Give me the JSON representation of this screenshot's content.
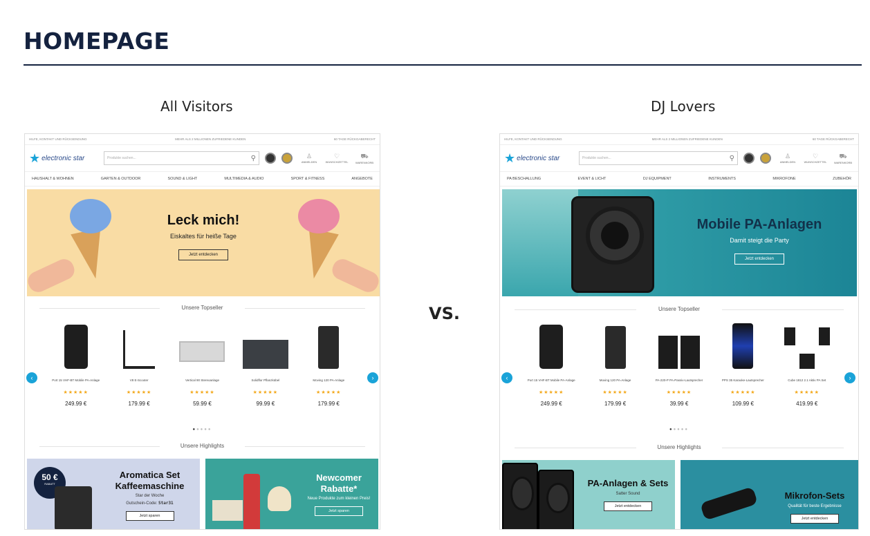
{
  "title": "HOMEPAGE",
  "vs": "VS.",
  "shared": {
    "topbar_left": "HILFE, KONTAKT UND RÜCKSENDUNG",
    "topbar_center": "MEHR ALS 2 MILLIONEN ZUFRIEDENE KUNDEN",
    "topbar_right": "60 TAGE RÜCKGABERECHT",
    "logo": "electronic star",
    "search_placeholder": "Produkte suchen...",
    "icon_login": "ANMELDEN",
    "icon_wishlist": "WUNSCHZETTEL",
    "icon_cart": "WARENKORB",
    "topseller": "Unsere Topseller",
    "highlights": "Unsere Highlights",
    "stars": "★★★★★"
  },
  "left": {
    "heading": "All Visitors",
    "nav": [
      "HAUSHALT & WOHNEN",
      "GARTEN & OUTDOOR",
      "SOUND & LIGHT",
      "MULTIMEDIA & AUDIO",
      "SPORT & FITNESS",
      "ANGEBOTE"
    ],
    "hero": {
      "title": "Leck mich!",
      "subtitle": "Eiskaltes für heiße Tage",
      "button": "Jetzt entdecken"
    },
    "products": [
      {
        "name": "Port 15 VHF-BT Mobile PA-Anlage",
        "price": "249.99 €"
      },
      {
        "name": "V8 E-Scooter",
        "price": "179.99 €"
      },
      {
        "name": "Vertical 90 Stereoanlage",
        "price": "59.99 €"
      },
      {
        "name": "Solidflor Pflanzkübel",
        "price": "99.99 €"
      },
      {
        "name": "Moving 120 PA-Anlage",
        "price": "179.99 €"
      }
    ],
    "tile1": {
      "badge": "50 €",
      "badge_sub": "RABATT",
      "title": "Aromatica Set Kaffeemaschine",
      "subtitle": "Star der Woche",
      "code_label": "Gutschein-Code:",
      "code": "Star31",
      "button": "Jetzt sparen"
    },
    "tile2": {
      "title": "Newcomer Rabatte*",
      "subtitle": "Neue Produkte zum kleinen Preis!",
      "button": "Jetzt sparen"
    }
  },
  "right": {
    "heading": "DJ Lovers",
    "nav": [
      "PA BESCHALLUNG",
      "EVENT & LICHT",
      "DJ EQUIPMENT",
      "INSTRUMENTS",
      "MIKROFONE",
      "ZUBEHÖR"
    ],
    "hero": {
      "title": "Mobile PA-Anlagen",
      "subtitle": "Damit steigt die Party",
      "button": "Jetzt entdecken"
    },
    "products": [
      {
        "name": "Port 15 VHF-BT Mobile PA-Anlage",
        "price": "249.99 €"
      },
      {
        "name": "Moving 120 PA-Anlage",
        "price": "179.99 €"
      },
      {
        "name": "PA-220-P PA-Passiv-Lautsprecher",
        "price": "39.99 €"
      },
      {
        "name": "PPS 35 Karaoke-Lautsprecher",
        "price": "109.99 €"
      },
      {
        "name": "Cube 1812 2.1 Aktiv PA Set",
        "price": "419.99 €"
      }
    ],
    "tile1": {
      "title": "PA-Anlagen & Sets",
      "subtitle": "Satter Sound",
      "button": "Jetzt entdecken"
    },
    "tile2": {
      "title": "Mikrofon-Sets",
      "subtitle": "Qualität für beste Ergebnisse",
      "button": "Jetzt entdecken"
    }
  },
  "colors": {
    "navy": "#14223f",
    "accent": "#1aa3d8",
    "star": "#f3a81a",
    "hero_left": "#f9dca4",
    "hero_right": "#2d9aa5"
  }
}
